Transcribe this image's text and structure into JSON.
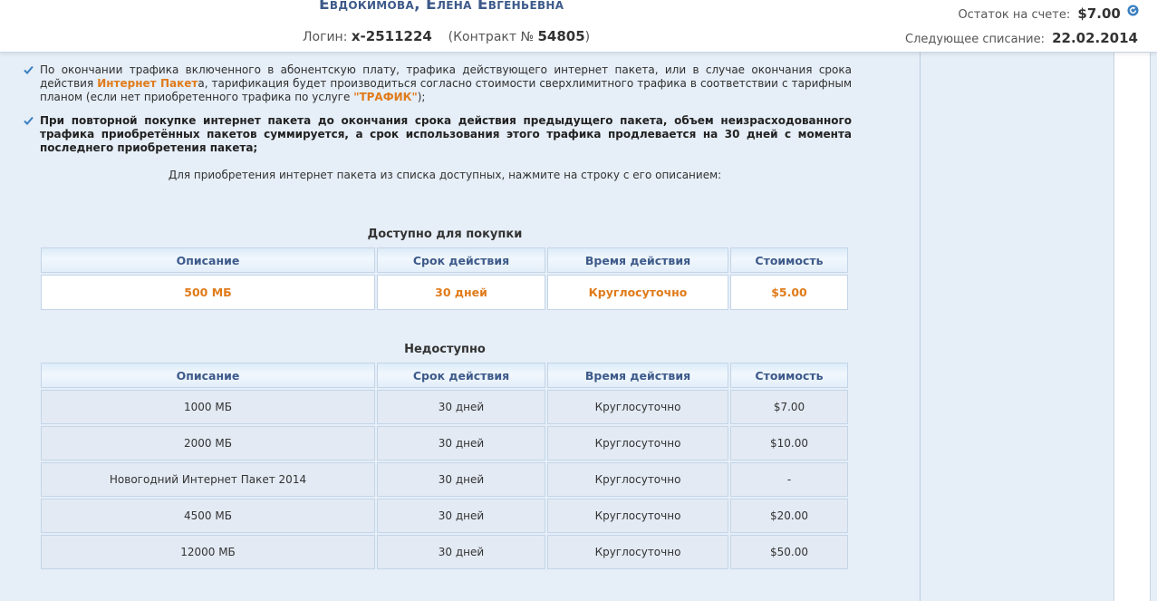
{
  "header": {
    "user_name": "Евдокимова, Елена Евгеньевна",
    "login_label": "Логин:",
    "login_value": "x-2511224",
    "contract_label": "(Контракт №",
    "contract_value": "54805",
    "contract_close": ")",
    "balance_label": "Остаток на счете:",
    "balance_value": "$7.00",
    "next_charge_label": "Следующее списание:",
    "next_charge_value": "22.02.2014"
  },
  "notes": {
    "note1_a": "По окончании трафика включенного в абонентскую плату, трафика действующего интернет пакета, или в случае окончания срока действия ",
    "note1_hl": "Интернет Пакет",
    "note1_b": "а, тарификация будет производиться согласно стоимости сверхлимитного трафика в соответствии с тарифным планом (если нет приобретенного трафика по услуге ",
    "note1_hl2": "\"ТРАФИК\"",
    "note1_c": ");",
    "note2": "При повторной покупке интернет пакета до окончания срока действия предыдущего пакета, объем неизрасходованного трафика приобретённых пакетов суммируется, а срок использования этого трафика продлевается на 30 дней с момента последнего приобретения пакета;",
    "instruction": "Для приобретения интернет пакета из списка доступных, нажмите на строку с его описанием:"
  },
  "available": {
    "title": "Доступно для покупки",
    "columns": [
      "Описание",
      "Срок действия",
      "Время действия",
      "Стоимость"
    ],
    "rows": [
      [
        "500 МБ",
        "30 дней",
        "Круглосуточно",
        "$5.00"
      ]
    ]
  },
  "unavailable": {
    "title": "Недоступно",
    "columns": [
      "Описание",
      "Срок действия",
      "Время действия",
      "Стоимость"
    ],
    "rows": [
      [
        "1000 МБ",
        "30 дней",
        "Круглосуточно",
        "$7.00"
      ],
      [
        "2000 МБ",
        "30 дней",
        "Круглосуточно",
        "$10.00"
      ],
      [
        "Новогодний Интернет Пакет 2014",
        "30 дней",
        "Круглосуточно",
        "-"
      ],
      [
        "4500 МБ",
        "30 дней",
        "Круглосуточно",
        "$20.00"
      ],
      [
        "12000 МБ",
        "30 дней",
        "Круглосуточно",
        "$50.00"
      ]
    ]
  },
  "colors": {
    "accent_orange": "#e07b1a",
    "header_blue": "#3d5a8a",
    "check_blue": "#3a7fc1"
  },
  "icons": {
    "refresh": "refresh-icon",
    "check": "checkmark-icon"
  }
}
